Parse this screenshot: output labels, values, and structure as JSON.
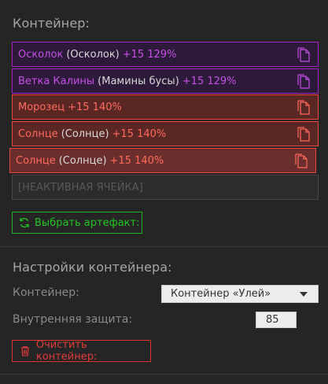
{
  "container": {
    "title": "Контейнер:",
    "slots": [
      {
        "name": "Осколок",
        "alt": "(Осколок)",
        "stat": "+15 129%",
        "tier": "purple"
      },
      {
        "name": "Ветка Калины",
        "alt": "(Мамины бусы)",
        "stat": "+15 129%",
        "tier": "purple"
      },
      {
        "name": "Морозец",
        "alt": "",
        "stat": "+15 140%",
        "tier": "red"
      },
      {
        "name": "Солнце",
        "alt": "(Солнце)",
        "stat": "+15 140%",
        "tier": "red"
      },
      {
        "name": "Солнце",
        "alt": "(Солнце)",
        "stat": "+15 140%",
        "tier": "red"
      }
    ],
    "inactive_slot": "[НЕАКТИВНАЯ ЯЧЕЙКА]",
    "select_artifact_label": "Выбрать артефакт:"
  },
  "settings": {
    "title": "Настройки контейнера:",
    "container_label": "Контейнер:",
    "container_value": "Контейнер «Улей»",
    "protection_label": "Внутренняя защита:",
    "protection_value": "85",
    "clear_label": "Очистить контейнер:"
  },
  "colors": {
    "purple": "#c64fe6",
    "red": "#ff6a5c",
    "green": "#22c522",
    "danger": "#e23b3b"
  },
  "icons": {
    "copy": "copy-icon",
    "refresh": "refresh-icon",
    "trash": "trash-icon",
    "dropdown": "chevron-down-icon"
  }
}
